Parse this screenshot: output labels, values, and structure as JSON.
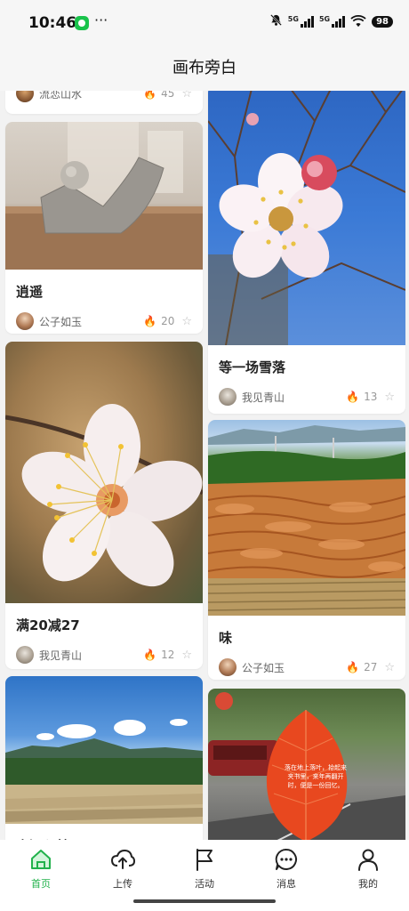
{
  "status_bar": {
    "time": "10:46",
    "more": "···",
    "signal_1": "5G",
    "signal_2": "5G",
    "battery": "98",
    "icons": [
      "app-notification-icon",
      "mute-icon",
      "signal-icon",
      "wifi-icon",
      "battery-icon"
    ]
  },
  "header": {
    "title": "画布旁白"
  },
  "cards": [
    {
      "title": "",
      "author": "流恋山水",
      "hot": "45"
    },
    {
      "title": "逍遥",
      "author": "公子如玉",
      "hot": "20"
    },
    {
      "title": "满20减27",
      "author": "我见青山",
      "hot": "12"
    },
    {
      "title": "山河入梦",
      "author": "",
      "hot": ""
    },
    {
      "title": "等一场雪落",
      "author": "我见青山",
      "hot": "13"
    },
    {
      "title": "味",
      "author": "公子如玉",
      "hot": "27"
    },
    {
      "title": "",
      "author": "",
      "hot": ""
    }
  ],
  "leaf_text": "落在地上落叶，拾起来夹书里，来年再翻开时，便是一份回忆。",
  "tabs": [
    {
      "label": "首页",
      "icon": "home-icon",
      "active": true
    },
    {
      "label": "上传",
      "icon": "upload-cloud-icon",
      "active": false
    },
    {
      "label": "活动",
      "icon": "flag-icon",
      "active": false
    },
    {
      "label": "消息",
      "icon": "message-icon",
      "active": false
    },
    {
      "label": "我的",
      "icon": "user-icon",
      "active": false
    }
  ],
  "colors": {
    "accent": "#22b24c",
    "hot": "#ff6a00",
    "background": "#f2f2f2"
  }
}
